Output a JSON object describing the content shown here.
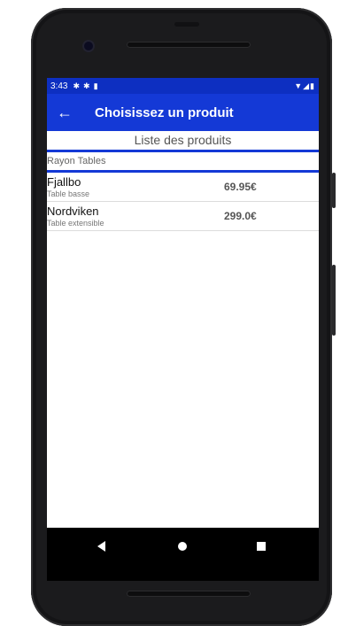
{
  "status_bar": {
    "time": "3:43",
    "left_icons": [
      "settings-icon",
      "settings-icon",
      "sd-card-icon"
    ],
    "right_icons": [
      "wifi-icon",
      "signal-icon",
      "battery-icon"
    ]
  },
  "app_bar": {
    "title": "Choisissez un produit",
    "back_icon": "arrow-left-icon"
  },
  "list": {
    "header": "Liste des produits",
    "section": "Rayon Tables",
    "items": [
      {
        "name": "Fjallbo",
        "description": "Table basse",
        "price": "69.95€"
      },
      {
        "name": "Nordviken",
        "description": "Table extensible",
        "price": "299.0€"
      }
    ]
  },
  "colors": {
    "status_bar": "#0d2fc1",
    "app_bar": "#1439d6",
    "divider": "#1439d6"
  },
  "nav_bar": {
    "icons": [
      "back-icon",
      "home-icon",
      "recents-icon"
    ]
  }
}
